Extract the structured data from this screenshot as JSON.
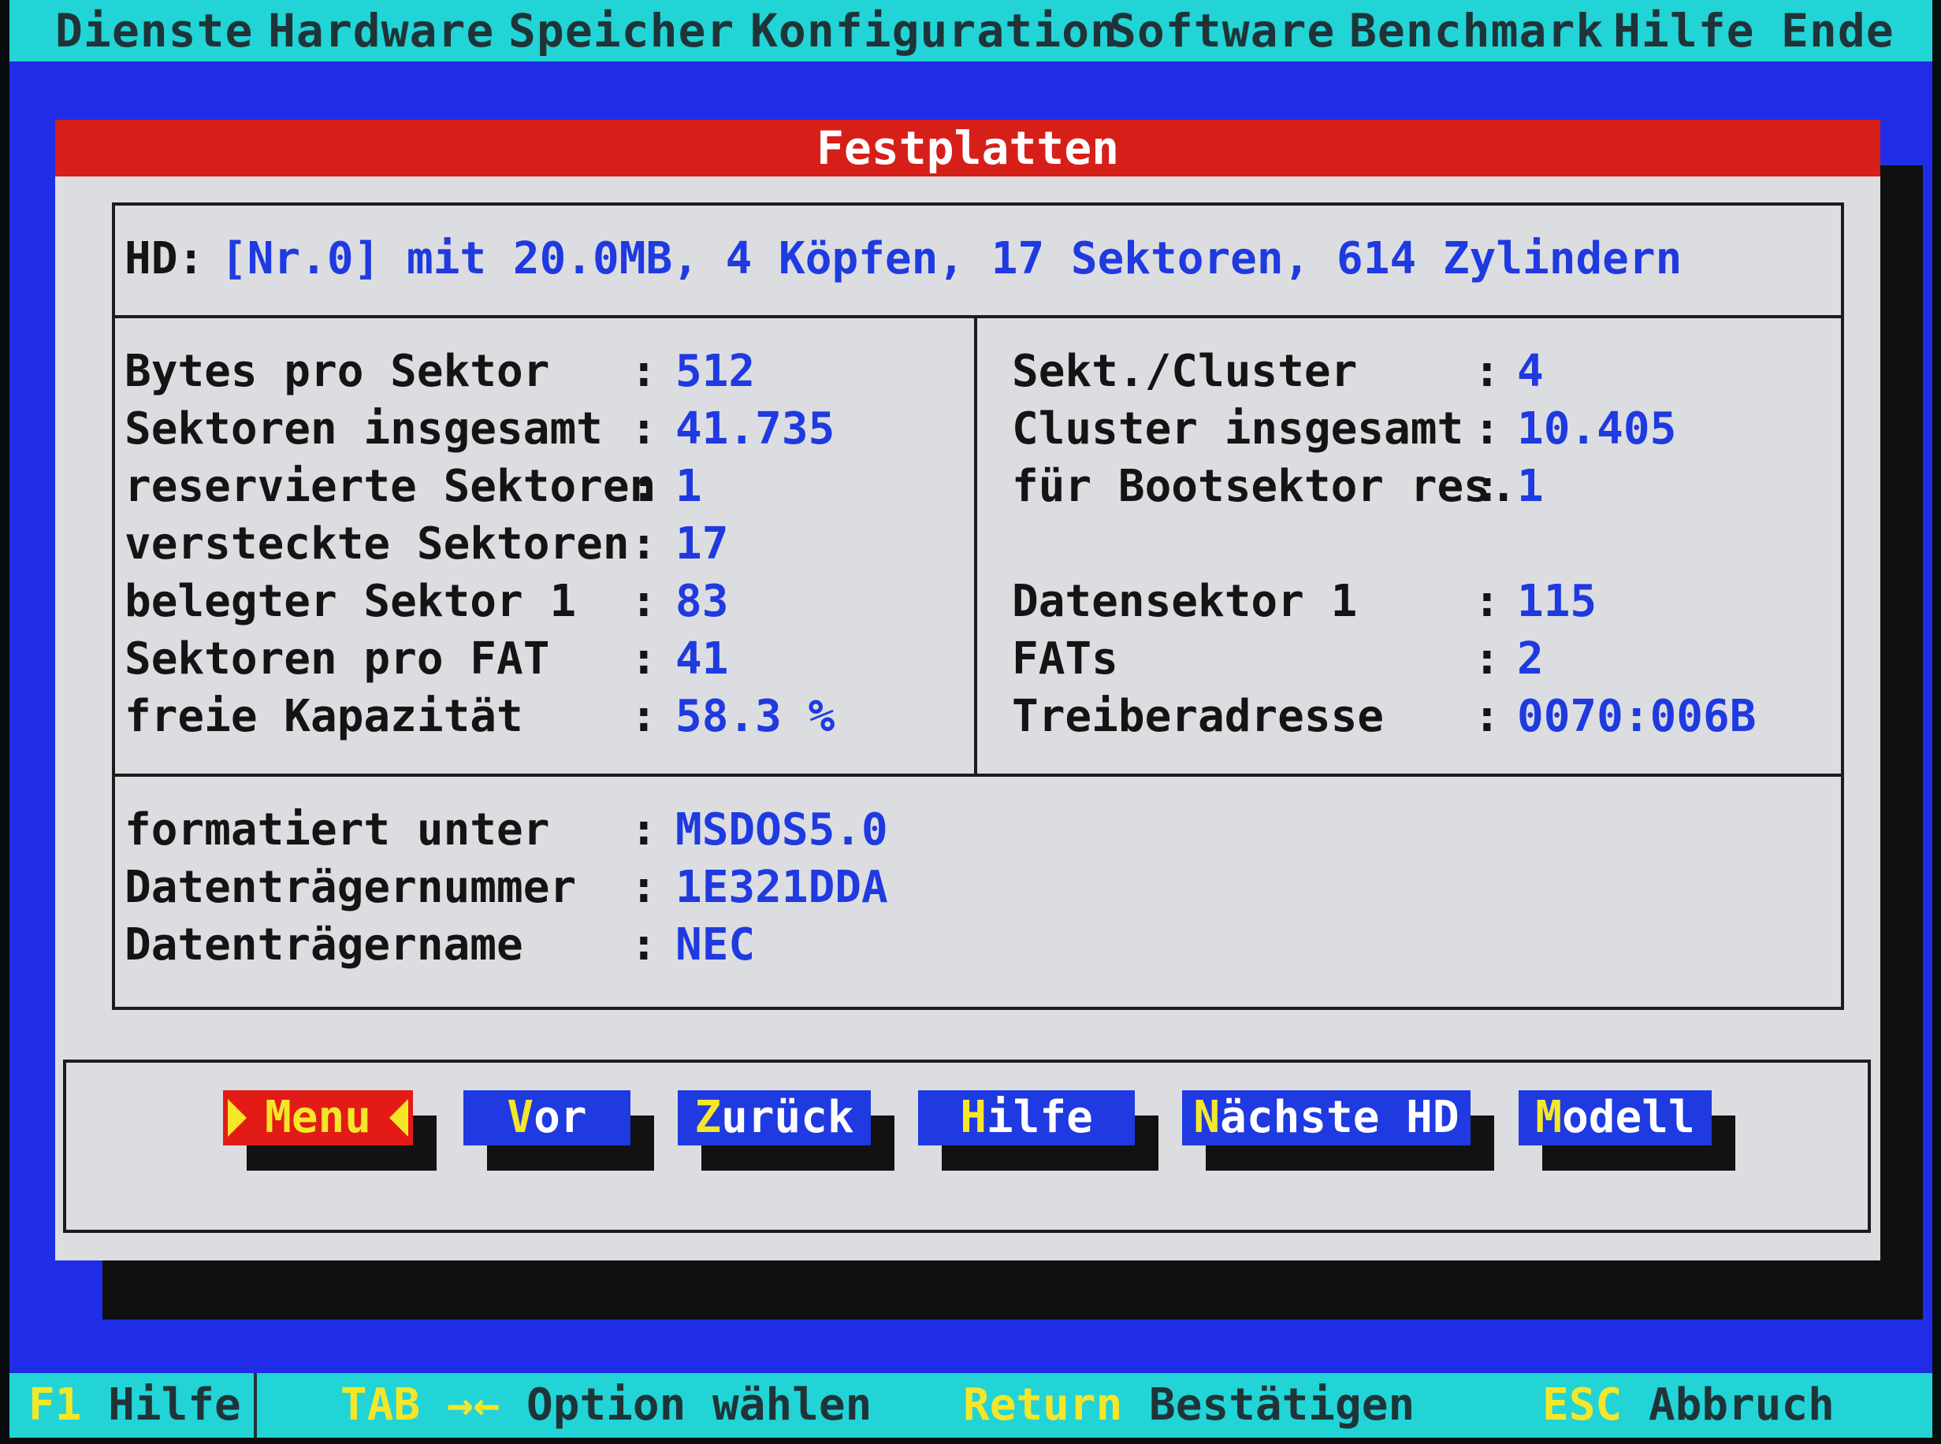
{
  "menu": [
    {
      "label": "Dienste"
    },
    {
      "label": "Hardware"
    },
    {
      "label": "Speicher"
    },
    {
      "label": "Konfiguration"
    },
    {
      "label": "Software"
    },
    {
      "label": "Benchmark"
    },
    {
      "label": "Hilfe"
    },
    {
      "label": "Ende"
    }
  ],
  "window": {
    "title": "Festplatten"
  },
  "hd": {
    "label": "HD:",
    "value": "[Nr.0] mit 20.0MB, 4 Köpfen, 17 Sektoren, 614 Zylindern"
  },
  "left_fields": [
    {
      "label": "Bytes pro Sektor",
      "value": "512"
    },
    {
      "label": "Sektoren insgesamt",
      "value": "41.735"
    },
    {
      "label": "reservierte Sektoren",
      "value": "1"
    },
    {
      "label": "versteckte Sektoren",
      "value": "17"
    },
    {
      "label": "belegter Sektor 1",
      "value": "83"
    },
    {
      "label": "Sektoren pro FAT",
      "value": "41"
    },
    {
      "label": "freie Kapazität",
      "value": "58.3 %"
    }
  ],
  "right_fields": [
    {
      "label": "Sekt./Cluster",
      "value": "4"
    },
    {
      "label": "Cluster insgesamt",
      "value": "10.405"
    },
    {
      "label": "für Bootsektor res.",
      "value": "1"
    },
    {
      "label": "Datensektor 1",
      "value": "115"
    },
    {
      "label": "FATs",
      "value": "2"
    },
    {
      "label": "Treiberadresse",
      "value": "0070:006B"
    }
  ],
  "bottom_fields": [
    {
      "label": "formatiert unter",
      "value": "MSDOS5.0"
    },
    {
      "label": "Datenträgernummer",
      "value": "1E321DDA"
    },
    {
      "label": "Datenträgername",
      "value": "NEC"
    }
  ],
  "separator": ":",
  "buttons": [
    {
      "hotkey": "M",
      "rest": "enu"
    },
    {
      "hotkey": "V",
      "rest": "or"
    },
    {
      "hotkey": "Z",
      "rest": "urück"
    },
    {
      "hotkey": "H",
      "rest": "ilfe"
    },
    {
      "hotkey": "N",
      "rest": "ächste HD"
    },
    {
      "hotkey": "M",
      "rest": "odell"
    }
  ],
  "status": [
    {
      "key": "F1",
      "text": "Hilfe"
    },
    {
      "key": "TAB →←",
      "text": "Option wählen"
    },
    {
      "key": "Return",
      "text": "Bestätigen"
    },
    {
      "key": "ESC",
      "text": "Abbruch"
    }
  ],
  "colors": {
    "desktop": "#1f2ee6",
    "menubar": "#22d4d6",
    "titlebar": "#d71f1a",
    "value_text": "#1f3ae0",
    "hotkey": "#f5e629"
  }
}
